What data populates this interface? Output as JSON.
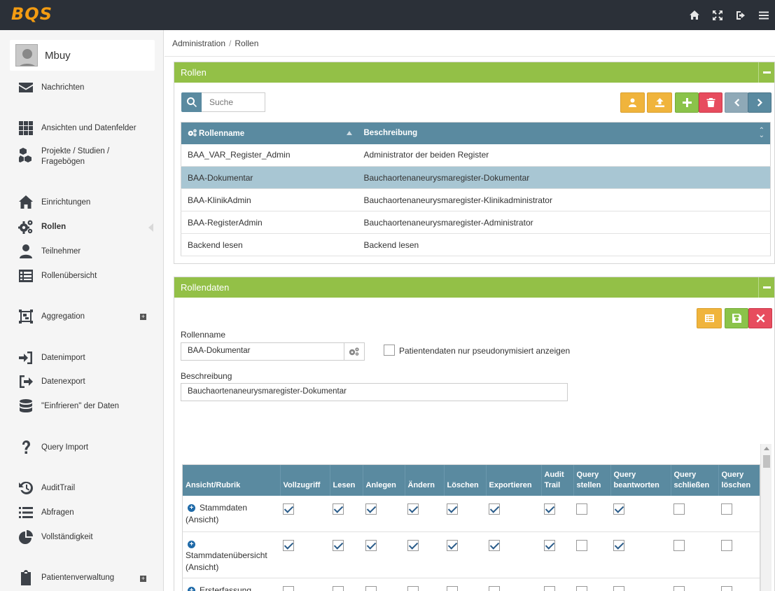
{
  "app": {
    "logo": "BQS"
  },
  "user": {
    "name": "Mbuy"
  },
  "sidebar": {
    "items": [
      {
        "label": "Nachrichten",
        "icon": "envelope-icon"
      },
      {
        "label": "Ansichten und Datenfelder",
        "icon": "grid-icon"
      },
      {
        "label": "Projekte / Studien /",
        "label2": "Fragebögen",
        "icon": "cubes-icon"
      },
      {
        "label": "Einrichtungen",
        "icon": "home-icon"
      },
      {
        "label": "Rollen",
        "icon": "gears-icon",
        "active": true
      },
      {
        "label": "Teilnehmer",
        "icon": "user-icon"
      },
      {
        "label": "Rollenübersicht",
        "icon": "list-alt-icon"
      },
      {
        "label": "Aggregation",
        "icon": "object-group-icon"
      },
      {
        "label": "Datenimport",
        "icon": "sign-in-icon"
      },
      {
        "label": "Datenexport",
        "icon": "sign-out-icon"
      },
      {
        "label": "\"Einfrieren\" der Daten",
        "icon": "database-icon"
      },
      {
        "label": "Query Import",
        "icon": "question-icon"
      },
      {
        "label": "AuditTrail",
        "icon": "history-icon"
      },
      {
        "label": "Abfragen",
        "icon": "list-icon"
      },
      {
        "label": "Vollständigkeit",
        "icon": "pie-chart-icon"
      },
      {
        "label": "Patientenverwaltung",
        "icon": "clipboard-icon"
      }
    ]
  },
  "breadcrumb": {
    "first": "Administration",
    "sep": "/",
    "second": "Rollen"
  },
  "roles_panel": {
    "title": "Rollen",
    "search_placeholder": "Suche",
    "columns": {
      "name": "Rollenname",
      "desc": "Beschreibung"
    },
    "rows": [
      {
        "name": "BAA_VAR_Register_Admin",
        "desc": "Administrator der beiden Register"
      },
      {
        "name": "BAA-Dokumentar",
        "desc": "Bauchaortenaneurysmaregister-Dokumentar",
        "selected": true
      },
      {
        "name": "BAA-KlinikAdmin",
        "desc": "Bauchaortenaneurysmaregister-Klinikadministrator"
      },
      {
        "name": "BAA-RegisterAdmin",
        "desc": "Bauchaortenaneurysmaregister-Administrator"
      },
      {
        "name": "Backend lesen",
        "desc": "Backend lesen"
      }
    ]
  },
  "role_data_panel": {
    "title": "Rollendaten",
    "rollenname_label": "Rollenname",
    "rollenname_value": "BAA-Dokumentar",
    "pseudonym_label": "Patientendaten nur pseudonymisiert anzeigen",
    "beschreibung_label": "Beschreibung",
    "beschreibung_value": "Bauchaortenaneurysmaregister-Dokumentar"
  },
  "rights_table": {
    "header": {
      "rubrik": "Ansicht/Rubrik",
      "cols": [
        {
          "l1": "Vollzugriff",
          "l2": ""
        },
        {
          "l1": "Lesen",
          "l2": ""
        },
        {
          "l1": "Anlegen",
          "l2": ""
        },
        {
          "l1": "Ändern",
          "l2": ""
        },
        {
          "l1": "Löschen",
          "l2": ""
        },
        {
          "l1": "Exportieren",
          "l2": ""
        },
        {
          "l1": "Audit",
          "l2": "Trail"
        },
        {
          "l1": "Query",
          "l2": "stellen"
        },
        {
          "l1": "Query",
          "l2": "beantworten"
        },
        {
          "l1": "Query",
          "l2": "schließen"
        },
        {
          "l1": "Query",
          "l2": "löschen"
        }
      ]
    },
    "rows": [
      {
        "name": "Stammdaten (Ansicht)",
        "checks": [
          true,
          true,
          true,
          true,
          true,
          true,
          true,
          false,
          true,
          false,
          false
        ]
      },
      {
        "name": "Stammdatenübersicht (Ansicht)",
        "checks": [
          true,
          true,
          true,
          true,
          true,
          true,
          true,
          false,
          true,
          false,
          false
        ]
      },
      {
        "name": "Ersterfassung QSVAR (Ansicht)",
        "checks": [
          false,
          false,
          false,
          false,
          false,
          false,
          false,
          false,
          false,
          false,
          false
        ]
      }
    ]
  }
}
